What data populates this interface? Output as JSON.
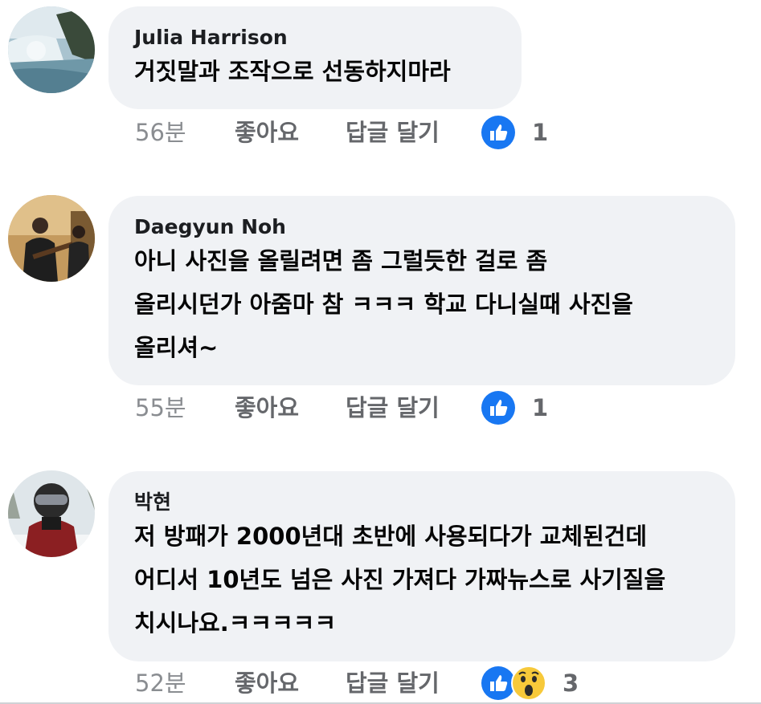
{
  "comments": [
    {
      "author": "Julia Harrison",
      "text": "거짓말과 조작으로 선동하지마라",
      "time": "56분",
      "like_label": "좋아요",
      "reply_label": "답글 달기",
      "reactions": [
        "like-icon"
      ],
      "reaction_count": "1"
    },
    {
      "author": "Daegyun Noh",
      "text": "아니 사진을 올릴려면 좀 그럴듯한 걸로 좀\n올리시던가 아줌마 참 ㅋㅋㅋ 학교 다니실때 사진을\n올리셔~",
      "time": "55분",
      "like_label": "좋아요",
      "reply_label": "답글 달기",
      "reactions": [
        "like-icon"
      ],
      "reaction_count": "1"
    },
    {
      "author": "박현",
      "text": "저 방패가 2000년대 초반에 사용되다가 교체된건데\n어디서 10년도 넘은 사진 가져다 가짜뉴스로 사기질을\n치시나요.ㅋㅋㅋㅋㅋ",
      "time": "52분",
      "like_label": "좋아요",
      "reply_label": "답글 달기",
      "reactions": [
        "like-icon",
        "wow-icon"
      ],
      "reaction_count": "3"
    }
  ],
  "colors": {
    "bubble": "#f0f2f5",
    "like_blue": "#1877f2",
    "wow_yellow": "#f7c93a",
    "meta_gray": "#65676b"
  }
}
